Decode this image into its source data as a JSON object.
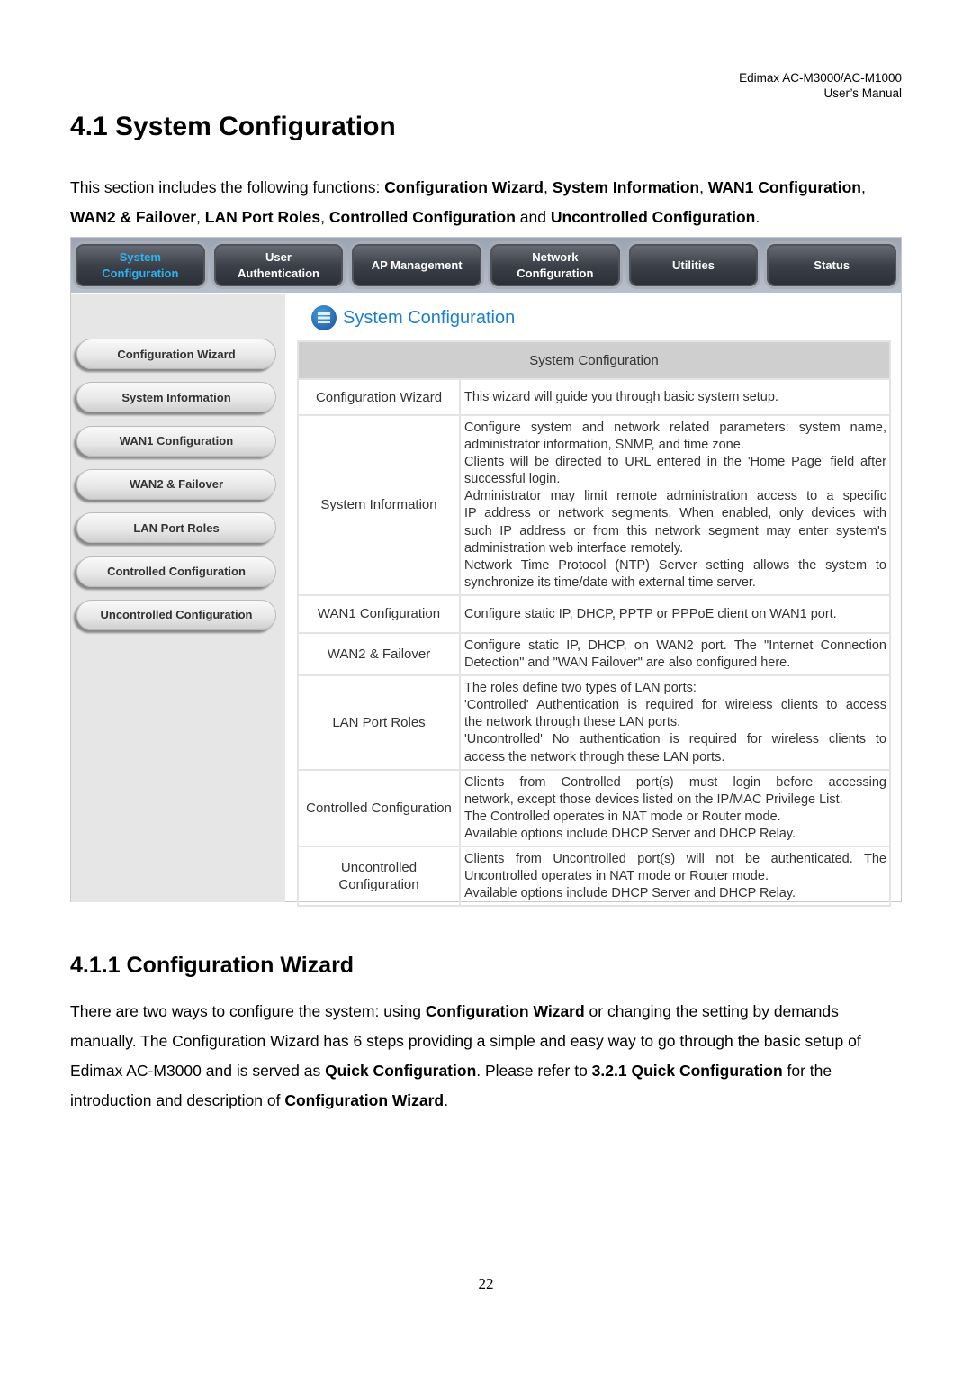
{
  "header": {
    "line1": "Edimax  AC-M3000/AC-M1000",
    "line2": "User’s  Manual"
  },
  "title": "4.1 System Configuration",
  "intro": [
    {
      "t": "This section includes the following functions: "
    },
    {
      "b": "Configuration Wizard"
    },
    {
      "t": ", "
    },
    {
      "b": "System Information"
    },
    {
      "t": ", "
    },
    {
      "b": "WAN1 Configuration"
    },
    {
      "t": ", "
    },
    {
      "b": "WAN2 & Failover"
    },
    {
      "t": ", "
    },
    {
      "b": "LAN Port Roles"
    },
    {
      "t": ", "
    },
    {
      "b": "Controlled Configuration"
    },
    {
      "t": " and "
    },
    {
      "b": "Uncontrolled Configuration"
    },
    {
      "t": "."
    }
  ],
  "screenshot": {
    "tabs": [
      {
        "label": "System Configuration",
        "active": true
      },
      {
        "label": "User Authentication"
      },
      {
        "label": "AP Management"
      },
      {
        "label": "Network Configuration"
      },
      {
        "label": "Utilities"
      },
      {
        "label": "Status"
      }
    ],
    "sidebar": [
      "Configuration Wizard",
      "System Information",
      "WAN1 Configuration",
      "WAN2 & Failover",
      "LAN Port Roles",
      "Controlled Configuration",
      "Uncontrolled Configuration"
    ],
    "content_title": "System Configuration",
    "content_icon": "grid-globe-icon",
    "accent": "#1a7fd0",
    "table_header": "System Configuration",
    "rows": [
      {
        "name": "Configuration Wizard",
        "desc": [
          "This wizard will guide you through basic system setup."
        ]
      },
      {
        "name": "System Information",
        "desc": [
          "Configure system and network related parameters: system name,",
          "administrator information, SNMP, and time zone.",
          "Clients will be directed to URL entered in the 'Home Page' field after",
          "successful login.",
          "Administrator may limit remote administration access to a specific",
          "IP address or network segments. When enabled, only devices with",
          "such IP address or from this network segment may enter system's",
          "administration web interface remotely.",
          "Network Time Protocol (NTP) Server setting allows the system to",
          "synchronize its time/date with external time server."
        ]
      },
      {
        "name": "WAN1 Configuration",
        "desc": [
          "Configure static IP, DHCP, PPTP or PPPoE client on WAN1 port."
        ]
      },
      {
        "name": "WAN2 & Failover",
        "desc": [
          "Configure static IP, DHCP, on WAN2 port. The \"Internet Connection",
          "Detection\" and \"WAN Failover\" are also configured here."
        ]
      },
      {
        "name": "LAN Port Roles",
        "desc": [
          "The roles define two types of LAN ports:",
          "'Controlled' Authentication is required for wireless clients to access",
          "the network through these LAN ports.",
          "'Uncontrolled' No authentication is required for wireless clients to",
          "access the network through these LAN ports."
        ]
      },
      {
        "name": "Controlled Configuration",
        "desc": [
          "Clients from Controlled port(s) must login before accessing",
          "network, except those devices listed on the IP/MAC Privilege List.",
          "The Controlled operates in NAT mode or Router mode.",
          "Available options include DHCP Server and DHCP Relay."
        ]
      },
      {
        "name": "Uncontrolled Configuration",
        "desc": [
          "Clients from Uncontrolled port(s) will not be authenticated. The",
          "Uncontrolled operates in NAT mode or Router mode.",
          "Available options include DHCP Server and DHCP Relay."
        ]
      }
    ]
  },
  "section": "4.1.1 Configuration Wizard",
  "body": [
    {
      "t": "There are two ways to configure the system: using "
    },
    {
      "b": "Configuration Wizard"
    },
    {
      "t": " or changing the setting by demands manually. The Configuration Wizard has 6 steps providing a simple and easy way to go through the basic setup of Edimax AC-M3000 and is served as "
    },
    {
      "b": "Quick Configuration"
    },
    {
      "t": ". Please refer to "
    },
    {
      "b": "3.2.1 Quick Configuration"
    },
    {
      "t": " for the introduction and description of "
    },
    {
      "b": "Configuration Wizard"
    },
    {
      "t": "."
    }
  ],
  "page_number": "22"
}
